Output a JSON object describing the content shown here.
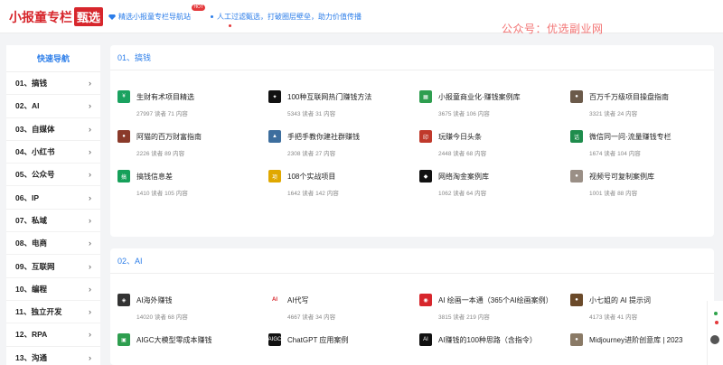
{
  "header": {
    "logo_main": "小报童专栏",
    "logo_boxed": "甄选",
    "nav_link": "精选小报童专栏导航站",
    "hot_badge": "HOT",
    "tagline": "人工过滤甄选，打破圈层壁垒，助力价值传播",
    "watermark": "公众号：优选副业网"
  },
  "sidebar": {
    "title": "快速导航",
    "items": [
      {
        "label": "01、搞钱"
      },
      {
        "label": "02、AI"
      },
      {
        "label": "03、自媒体"
      },
      {
        "label": "04、小红书"
      },
      {
        "label": "05、公众号"
      },
      {
        "label": "06、IP"
      },
      {
        "label": "07、私域"
      },
      {
        "label": "08、电商"
      },
      {
        "label": "09、互联网"
      },
      {
        "label": "10、编程"
      },
      {
        "label": "11、独立开发"
      },
      {
        "label": "12、RPA"
      },
      {
        "label": "13、沟通"
      }
    ]
  },
  "sections": [
    {
      "heading": "01、搞钱",
      "cards": [
        {
          "title": "生财有术项目精选",
          "meta": "27997 读者 71 内容",
          "icon": "coin-icon",
          "color": "#1aa260",
          "glyph": "¥"
        },
        {
          "title": "100种互联网热门赚钱方法",
          "meta": "5343 读者 31 内容",
          "icon": "spark-icon",
          "color": "#111111",
          "glyph": "✦"
        },
        {
          "title": "小报童商业化·赚钱案例库",
          "meta": "3675 读者 106 内容",
          "icon": "grid-icon",
          "color": "#2e9e4f",
          "glyph": "▦"
        },
        {
          "title": "百万千万级项目操盘指南",
          "meta": "3321 读者 24 内容",
          "icon": "avatar-icon",
          "color": "#6b5a4a",
          "glyph": "●"
        },
        {
          "title": "阿猫的百万财富指南",
          "meta": "2226 读者 89 内容",
          "icon": "avatar-icon",
          "color": "#8a3a2a",
          "glyph": "●"
        },
        {
          "title": "手把手教你建社群赚钱",
          "meta": "2308 读者 27 内容",
          "icon": "landscape-icon",
          "color": "#3d6e9e",
          "glyph": "▲"
        },
        {
          "title": "玩赚今日头条",
          "meta": "2448 读者 68 内容",
          "icon": "stamp-icon",
          "color": "#c0392b",
          "glyph": "印"
        },
        {
          "title": "微信同一问·流量赚钱专栏",
          "meta": "1674 读者 104 内容",
          "icon": "chat-icon",
          "color": "#1e8c4c",
          "glyph": "话"
        },
        {
          "title": "搞钱信息差",
          "meta": "1410 读者 105 内容",
          "icon": "badge-icon",
          "color": "#16a05a",
          "glyph": "搞"
        },
        {
          "title": "108个实战项目",
          "meta": "1642 读者 142 内容",
          "icon": "book-icon",
          "color": "#e0a800",
          "glyph": "项"
        },
        {
          "title": "网络淘金案例库",
          "meta": "1062 读者 64 内容",
          "icon": "cube-icon",
          "color": "#111111",
          "glyph": "◆"
        },
        {
          "title": "视频号可复制案例库",
          "meta": "1001 读者 88 内容",
          "icon": "avatar-icon",
          "color": "#9a8f86",
          "glyph": "●"
        }
      ]
    },
    {
      "heading": "02、AI",
      "cards": [
        {
          "title": "AI海外赚钱",
          "meta": "14020 读者 68 内容",
          "icon": "robot-icon",
          "color": "#333333",
          "glyph": "◈"
        },
        {
          "title": "AI代写",
          "meta": "4667 读者 34 内容",
          "icon": "pen-icon",
          "color": "#ffffff",
          "glyph": "AI"
        },
        {
          "title": "AI 绘画一本通（365个AI绘画案例）",
          "meta": "3815 读者 219 内容",
          "icon": "paint-icon",
          "color": "#d7262c",
          "glyph": "◉"
        },
        {
          "title": "小七姐的 AI 提示词",
          "meta": "4173 读者 41 内容",
          "icon": "avatar-icon",
          "color": "#6b4a2a",
          "glyph": "●"
        },
        {
          "title": "AIGC大模型零成本赚钱",
          "meta": "",
          "icon": "aigc-icon",
          "color": "#2e9e4f",
          "glyph": "▣"
        },
        {
          "title": "ChatGPT 应用案例",
          "meta": "",
          "icon": "gpt-icon",
          "color": "#111111",
          "glyph": "AIGC"
        },
        {
          "title": "AI赚钱的100种思路（含指令）",
          "meta": "",
          "icon": "ai-icon",
          "color": "#111111",
          "glyph": "AI"
        },
        {
          "title": "Midjourney进阶创意库 | 2023",
          "meta": "",
          "icon": "avatar-icon",
          "color": "#8a7a66",
          "glyph": "●"
        }
      ]
    }
  ]
}
